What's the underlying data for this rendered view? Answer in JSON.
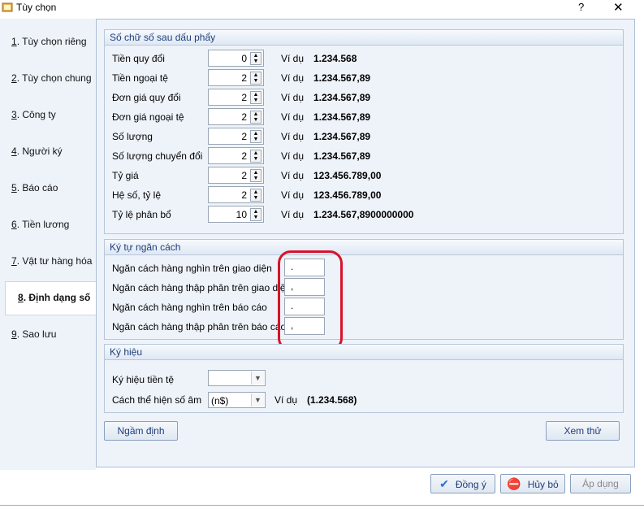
{
  "window": {
    "title": "Tùy chọn",
    "help": "?",
    "close": "✕"
  },
  "sidebar": {
    "items": [
      {
        "num": "1",
        "label": ". Tùy chọn riêng"
      },
      {
        "num": "2",
        "label": ". Tùy chọn chung"
      },
      {
        "num": "3",
        "label": ". Công ty"
      },
      {
        "num": "4",
        "label": ". Người ký"
      },
      {
        "num": "5",
        "label": ". Báo cáo"
      },
      {
        "num": "6",
        "label": ". Tiền lương"
      },
      {
        "num": "7",
        "label": ". Vật tư hàng hóa"
      },
      {
        "num": "8",
        "label": ". Định dạng số"
      },
      {
        "num": "9",
        "label": ". Sao lưu"
      }
    ]
  },
  "decimals": {
    "title": "Số chữ số sau dấu phẩy",
    "example_label": "Ví dụ",
    "rows": [
      {
        "label": "Tiền quy đổi",
        "value": "0",
        "example": "1.234.568"
      },
      {
        "label": "Tiền ngoại tệ",
        "value": "2",
        "example": "1.234.567,89"
      },
      {
        "label": "Đơn giá quy đổi",
        "value": "2",
        "example": "1.234.567,89"
      },
      {
        "label": "Đơn giá ngoại tệ",
        "value": "2",
        "example": "1.234.567,89"
      },
      {
        "label": "Số lượng",
        "value": "2",
        "example": "1.234.567,89"
      },
      {
        "label": "Số lượng chuyển đổi",
        "value": "2",
        "example": "1.234.567,89"
      },
      {
        "label": "Tỷ giá",
        "value": "2",
        "example": "123.456.789,00"
      },
      {
        "label": "Hệ số, tỷ lệ",
        "value": "2",
        "example": "123.456.789,00"
      },
      {
        "label": "Tỷ lệ phân bổ",
        "value": "10",
        "example": "1.234.567,8900000000"
      }
    ]
  },
  "separators": {
    "title": "Ký tự ngăn cách",
    "rows": [
      {
        "label": "Ngăn cách hàng nghìn trên giao diện",
        "value": "."
      },
      {
        "label": "Ngăn cách hàng thập phân trên giao diện",
        "value": ","
      },
      {
        "label": "Ngăn cách hàng nghìn trên báo cáo",
        "value": "."
      },
      {
        "label": "Ngăn cách hàng thập phân trên báo cáo",
        "value": ","
      }
    ]
  },
  "symbols": {
    "title": "Ký hiệu",
    "currency_label": "Ký hiệu tiền tệ",
    "currency_value": "",
    "negative_label": "Cách thể hiện số âm",
    "negative_value": "(n$)",
    "example_label": "Ví dụ",
    "example_value": "(1.234.568)"
  },
  "buttons": {
    "default": "Ngầm định",
    "preview": "Xem thử",
    "ok": "Đồng ý",
    "cancel": "Hủy bỏ",
    "apply": "Áp dụng"
  },
  "colors": {
    "highlight": "#d8132a",
    "accent": "#1f3e79"
  }
}
